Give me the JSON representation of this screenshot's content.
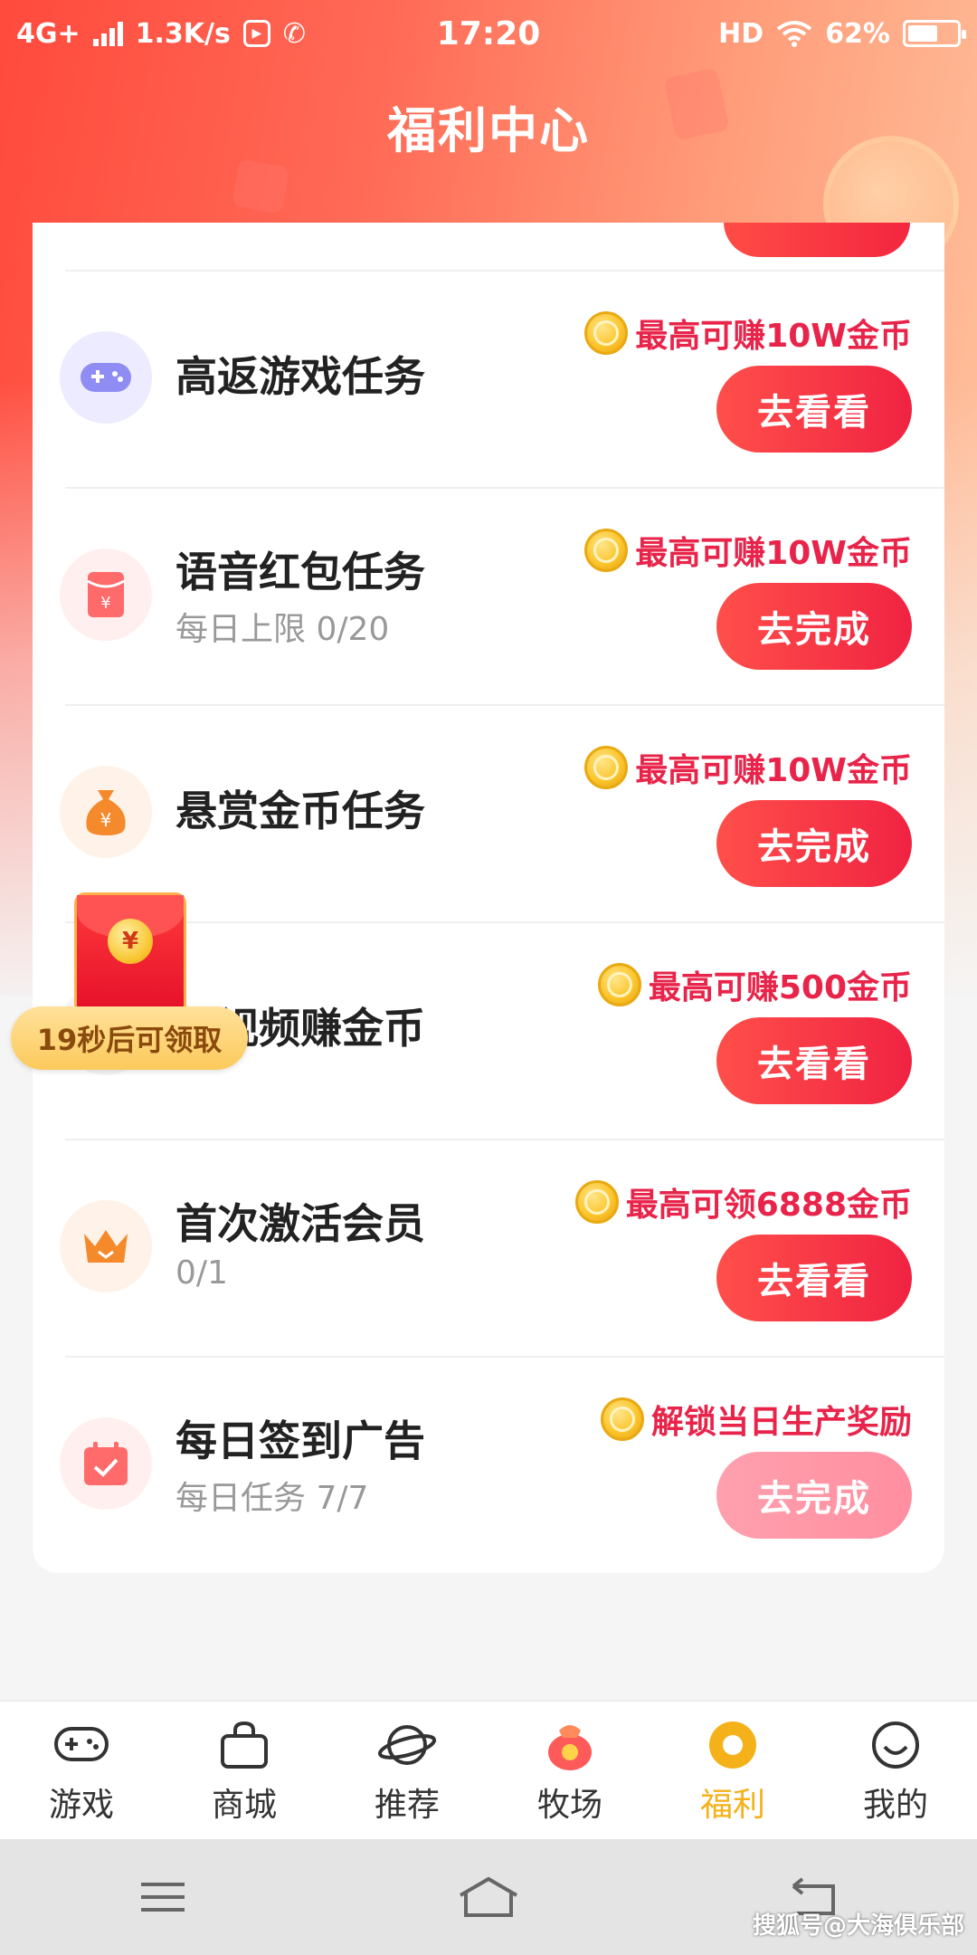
{
  "status_bar": {
    "network": "4G+",
    "speed": "1.3K/s",
    "time": "17:20",
    "hd": "HD",
    "battery": "62%",
    "battery_level": 0.62
  },
  "page_title": "福利中心",
  "tasks": [
    {
      "title": "高返游戏任务",
      "subtitle": "",
      "reward": "最高可赚10W金币",
      "button": "去看看",
      "icon": "gamepad-icon",
      "button_enabled": true
    },
    {
      "title": "语音红包任务",
      "subtitle": "每日上限 0/20",
      "reward": "最高可赚10W金币",
      "button": "去完成",
      "icon": "red-envelope-icon",
      "button_enabled": true
    },
    {
      "title": "悬赏金币任务",
      "subtitle": "",
      "reward": "最高可赚10W金币",
      "button": "去完成",
      "icon": "money-bag-icon",
      "button_enabled": true
    },
    {
      "title": "狂视频赚金币",
      "subtitle": "",
      "reward": "最高可赚500金币",
      "button": "去看看",
      "icon": "video-icon",
      "button_enabled": true
    },
    {
      "title": "首次激活会员",
      "subtitle": "0/1",
      "reward": "最高可领6888金币",
      "button": "去看看",
      "icon": "crown-icon",
      "button_enabled": true
    },
    {
      "title": "每日签到广告",
      "subtitle": "每日任务 7/7",
      "reward": "解锁当日生产奖励",
      "button": "去完成",
      "icon": "calendar-check-icon",
      "button_enabled": false
    }
  ],
  "floating_packet": {
    "symbol": "¥",
    "timer_text": "19秒后可领取"
  },
  "bottom_nav": [
    {
      "label": "游戏",
      "icon": "gamepad-icon",
      "active": false
    },
    {
      "label": "商城",
      "icon": "shopping-bag-icon",
      "active": false
    },
    {
      "label": "推荐",
      "icon": "planet-icon",
      "active": false
    },
    {
      "label": "牧场",
      "icon": "ranch-bag-icon",
      "active": false
    },
    {
      "label": "福利",
      "icon": "welfare-coin-icon",
      "active": true
    },
    {
      "label": "我的",
      "icon": "smiley-icon",
      "active": false
    }
  ],
  "colors": {
    "accent_red": "#f02342",
    "reward_text": "#e8244a",
    "active_nav": "#f4b11a"
  },
  "watermark": "搜狐号@大海俱乐部"
}
